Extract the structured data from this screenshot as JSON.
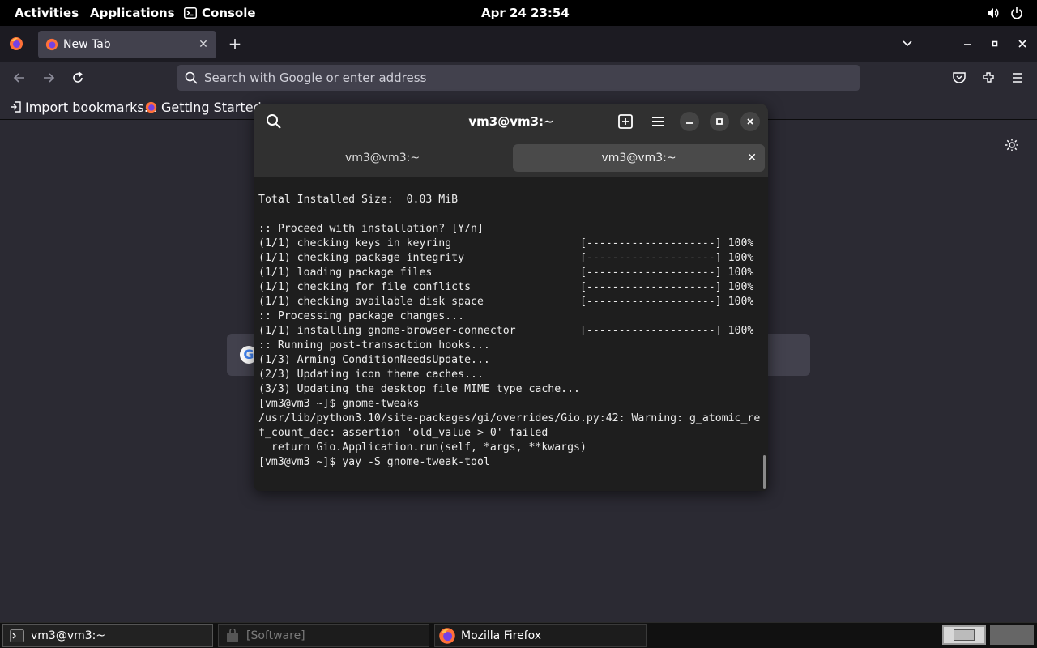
{
  "topbar": {
    "activities": "Activities",
    "applications": "Applications",
    "console": "Console",
    "clock": "Apr 24  23:54",
    "icons": [
      "volume-icon",
      "power-icon"
    ]
  },
  "firefox": {
    "tab_title": "New Tab",
    "url_placeholder": "Search with Google or enter address",
    "bookmarks": [
      "Import bookmarks…",
      "Getting Started"
    ],
    "icons": [
      "firefox-logo-icon",
      "back-icon",
      "forward-icon",
      "reload-icon",
      "pocket-icon",
      "extensions-icon",
      "menu-icon",
      "settings-gear-icon"
    ]
  },
  "console": {
    "title": "vm3@vm3:~",
    "tabs": [
      {
        "label": "vm3@vm3:~",
        "active": false
      },
      {
        "label": "vm3@vm3:~",
        "active": true
      }
    ],
    "lines": [
      "Total Installed Size:  0.03 MiB",
      "",
      ":: Proceed with installation? [Y/n]",
      "(1/1) checking keys in keyring                    [--------------------] 100%",
      "(1/1) checking package integrity                  [--------------------] 100%",
      "(1/1) loading package files                       [--------------------] 100%",
      "(1/1) checking for file conflicts                 [--------------------] 100%",
      "(1/1) checking available disk space               [--------------------] 100%",
      ":: Processing package changes...",
      "(1/1) installing gnome-browser-connector          [--------------------] 100%",
      ":: Running post-transaction hooks...",
      "(1/3) Arming ConditionNeedsUpdate...",
      "(2/3) Updating icon theme caches...",
      "(3/3) Updating the desktop file MIME type cache...",
      "[vm3@vm3 ~]$ gnome-tweaks",
      "/usr/lib/python3.10/site-packages/gi/overrides/Gio.py:42: Warning: g_atomic_re",
      "f_count_dec: assertion 'old_value > 0' failed",
      "  return Gio.Application.run(self, *args, **kwargs)",
      "[vm3@vm3 ~]$ yay -S gnome-tweak-tool"
    ]
  },
  "taskbar": {
    "tasks": [
      "vm3@vm3:~",
      "[Software]",
      "Mozilla Firefox"
    ]
  }
}
